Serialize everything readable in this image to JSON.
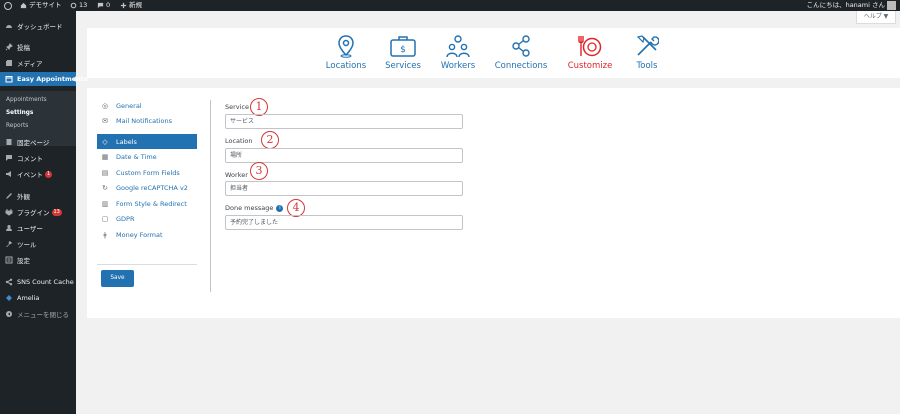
{
  "adminbar": {
    "site_name": "デモサイト",
    "updates_count": "13",
    "comments_count": "0",
    "new_label": "新規",
    "greeting": "こんにちは、hanami さん"
  },
  "help_label": "ヘルプ ▼",
  "sidebar": {
    "items": [
      {
        "label": "ダッシュボード"
      },
      {
        "label": "投稿"
      },
      {
        "label": "メディア"
      },
      {
        "label": "Easy Appointments"
      },
      {
        "label": "固定ページ"
      },
      {
        "label": "コメント"
      },
      {
        "label": "イベント",
        "badge": "1"
      },
      {
        "label": "外観"
      },
      {
        "label": "プラグイン",
        "badge": "13"
      },
      {
        "label": "ユーザー"
      },
      {
        "label": "ツール"
      },
      {
        "label": "設定"
      },
      {
        "label": "SNS Count Cache"
      },
      {
        "label": "Amelia"
      },
      {
        "label": "メニューを閉じる"
      }
    ],
    "submenu": [
      "Appointments",
      "Settings",
      "Reports"
    ]
  },
  "topnav": [
    {
      "label": "Locations",
      "icon": "location-pin-icon"
    },
    {
      "label": "Services",
      "icon": "briefcase-icon"
    },
    {
      "label": "Workers",
      "icon": "workers-icon"
    },
    {
      "label": "Connections",
      "icon": "connections-icon"
    },
    {
      "label": "Customize",
      "icon": "customize-icon",
      "highlight": true
    },
    {
      "label": "Tools",
      "icon": "tools-icon"
    }
  ],
  "settings_tabs": [
    {
      "label": "General",
      "icon": "gear-icon"
    },
    {
      "label": "Mail Notifications",
      "icon": "envelope-icon"
    },
    {
      "label": "Labels",
      "icon": "tag-icon",
      "active": true
    },
    {
      "label": "Date & Time",
      "icon": "calendar-icon"
    },
    {
      "label": "Custom Form Fields",
      "icon": "form-icon"
    },
    {
      "label": "Google reCAPTCHA v2",
      "icon": "recaptcha-icon"
    },
    {
      "label": "Form Style & Redirect",
      "icon": "style-icon"
    },
    {
      "label": "GDPR",
      "icon": "lock-icon"
    },
    {
      "label": "Money Format",
      "icon": "money-icon"
    }
  ],
  "save_label": "Save",
  "fields": [
    {
      "label": "Service",
      "value": "サービス",
      "marker": "1"
    },
    {
      "label": "Location",
      "value": "場所",
      "marker": "2"
    },
    {
      "label": "Worker",
      "value": "担当者",
      "marker": "3"
    },
    {
      "label": "Done message",
      "value": "予約完了しました",
      "marker": "4"
    }
  ],
  "colors": {
    "accent": "#2271b1",
    "highlight": "#e0242b",
    "admin_dark": "#1d2327"
  }
}
